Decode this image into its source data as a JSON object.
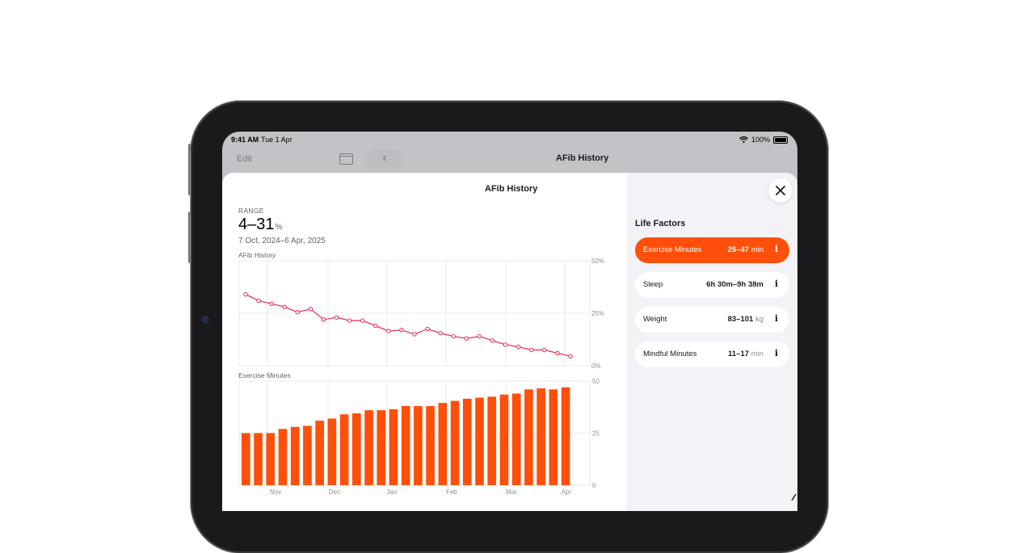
{
  "status_bar": {
    "time": "9:41 AM",
    "date": "Tue 1 Apr",
    "battery": "100%"
  },
  "nav": {
    "edit_label": "Edit",
    "back_glyph": "‹",
    "title": "AFib History"
  },
  "sheet": {
    "title": "AFib History",
    "range_label": "RANGE",
    "range_value": "4–31",
    "range_unit": "%",
    "date_range": "7 Oct, 2024–6 Apr, 2025"
  },
  "life_factors": {
    "title": "Life Factors",
    "items": [
      {
        "name": "Exercise Minutes",
        "value": "25–47",
        "unit": "min",
        "selected": true
      },
      {
        "name": "Sleep",
        "value": "6h 30m–9h 38m",
        "unit": "",
        "selected": false
      },
      {
        "name": "Weight",
        "value": "83–101",
        "unit": "kg",
        "selected": false
      },
      {
        "name": "Mindful Minutes",
        "value": "11–17",
        "unit": "min",
        "selected": false
      }
    ]
  },
  "colors": {
    "accent": "#ff4f0a",
    "line": "#e8294f",
    "grid": "#e5e5ea"
  },
  "icons": {
    "close": "close-icon",
    "info": "info-icon",
    "sidebar": "sidebar-icon",
    "back": "chevron-left-icon",
    "wifi": "wifi-icon",
    "battery": "battery-icon"
  },
  "chart_data": [
    {
      "type": "line",
      "title": "AFib History",
      "y_tick_labels": [
        "50%",
        "25%",
        "0%"
      ],
      "ylim": [
        0,
        50
      ],
      "values": [
        34,
        31,
        29.5,
        28,
        25.5,
        27,
        22,
        23,
        21.5,
        21.5,
        19,
        16.5,
        17,
        15,
        17.5,
        15.5,
        14,
        13,
        14,
        12,
        10,
        9,
        7.5,
        7.5,
        6,
        4.5
      ]
    },
    {
      "type": "bar",
      "title": "Exercise Minutes",
      "x_tick_labels": [
        "Nov",
        "Dec",
        "Jan",
        "Feb",
        "Mar",
        "Apr"
      ],
      "y_tick_labels": [
        "50",
        "25",
        "0"
      ],
      "ylim": [
        0,
        50
      ],
      "values": [
        25,
        25,
        25,
        27,
        28,
        28.5,
        31,
        32,
        34,
        34.5,
        36,
        36,
        36.5,
        38,
        38,
        38,
        39.5,
        40.5,
        41.5,
        42,
        42.5,
        43.5,
        44,
        46,
        46.5,
        46,
        47
      ]
    }
  ]
}
